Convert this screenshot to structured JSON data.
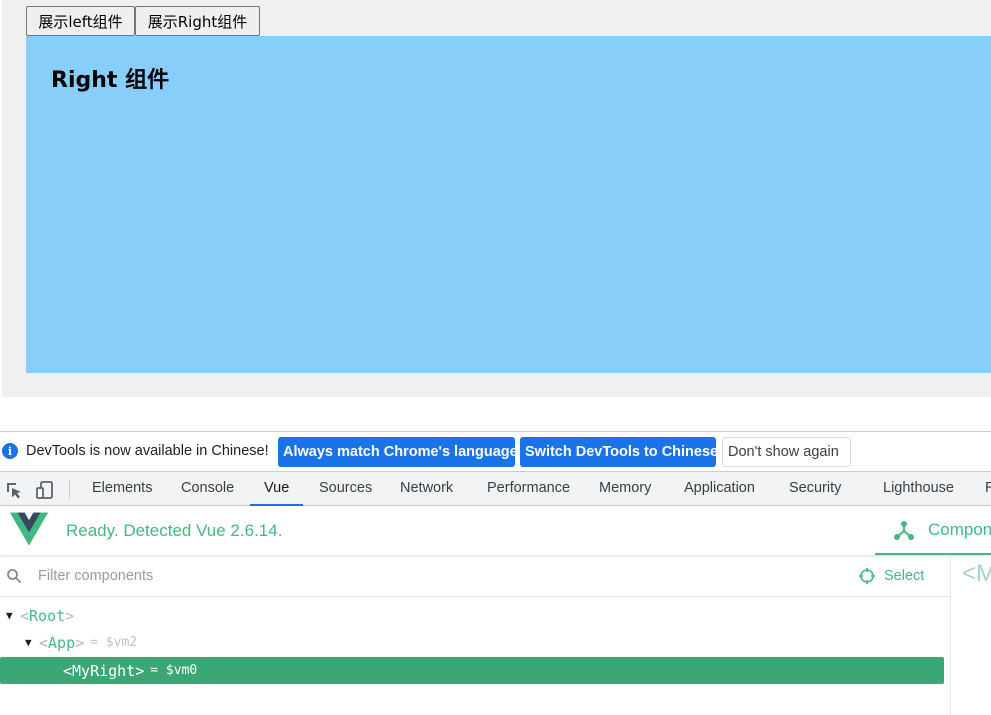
{
  "page": {
    "buttons": {
      "show_left": "展示left组件",
      "show_right": "展示Right组件"
    },
    "right_component": {
      "title": "Right 组件",
      "background": "#87cefa"
    }
  },
  "devtools": {
    "infobar": {
      "message": "DevTools is now available in Chinese!",
      "btn_match": "Always match Chrome's language",
      "btn_switch": "Switch DevTools to Chinese",
      "btn_dismiss": "Don't show again"
    },
    "tabs": [
      "Elements",
      "Console",
      "Vue",
      "Sources",
      "Network",
      "Performance",
      "Memory",
      "Application",
      "Security",
      "Lighthouse",
      "R"
    ],
    "active_tab": "Vue",
    "accent": "#1a73e8"
  },
  "vue": {
    "status": "Ready. Detected Vue 2.6.14.",
    "components_tab": "Components",
    "filter_placeholder": "Filter components",
    "select_label": "Select",
    "inspector_peek": "<M",
    "brand_color": "#42b983",
    "tree": [
      {
        "name": "Root",
        "vm": "",
        "expanded": true,
        "selected": false
      },
      {
        "name": "App",
        "vm": "= $vm2",
        "expanded": true,
        "selected": false
      },
      {
        "name": "MyRight",
        "vm": "= $vm0",
        "expanded": false,
        "selected": true
      }
    ]
  }
}
